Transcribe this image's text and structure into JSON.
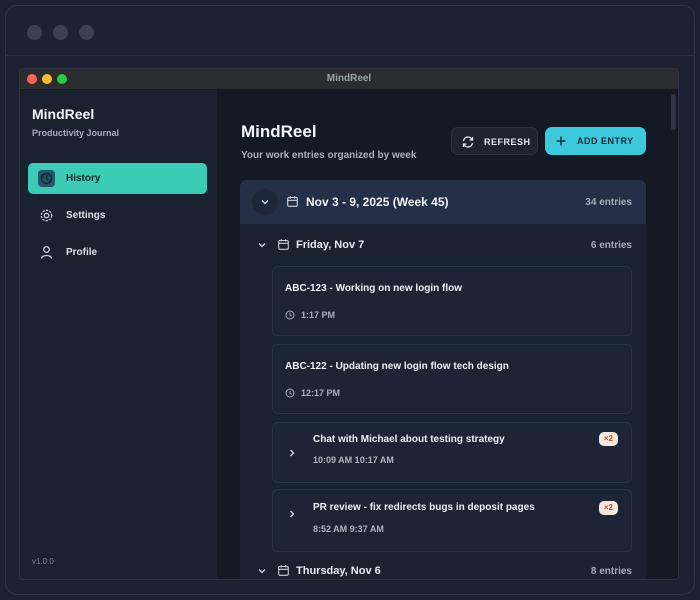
{
  "window": {
    "title": "MindReel"
  },
  "sidebar": {
    "app_name": "MindReel",
    "app_subtitle": "Productivity Journal",
    "items": [
      {
        "label": "History",
        "icon": "history-icon",
        "active": true
      },
      {
        "label": "Settings",
        "icon": "gear-icon",
        "active": false
      },
      {
        "label": "Profile",
        "icon": "user-icon",
        "active": false
      }
    ],
    "version": "v1.0.0"
  },
  "header": {
    "title": "MindReel",
    "subtitle": "Your work entries organized by week",
    "refresh_label": "REFRESH",
    "add_label": "ADD ENTRY"
  },
  "week": {
    "label": "Nov 3 - 9, 2025 (Week 45)",
    "count": "34 entries",
    "days": [
      {
        "label": "Friday, Nov 7",
        "count": "6 entries",
        "entries": [
          {
            "title": "ABC-123 - Working on new login flow",
            "time": "1:17 PM"
          },
          {
            "title": "ABC-122 - Updating new login flow tech design",
            "time": "12:17 PM"
          },
          {
            "title": "Chat with Michael about testing strategy",
            "times": "10:09 AM  10:17 AM",
            "badge": "×2"
          },
          {
            "title": "PR review - fix redirects bugs in deposit pages",
            "times": "8:52 AM  9:37 AM",
            "badge": "×2"
          }
        ]
      },
      {
        "label": "Thursday, Nov 6",
        "count": "8 entries"
      }
    ]
  },
  "colors": {
    "accent_teal": "#3ccbb6",
    "accent_cyan": "#3cc9dd",
    "badge_bg": "#f6e8dc",
    "badge_text": "#c2562b",
    "traffic_red": "#ff5f57",
    "traffic_yellow": "#febc2e",
    "traffic_green": "#28c840"
  }
}
